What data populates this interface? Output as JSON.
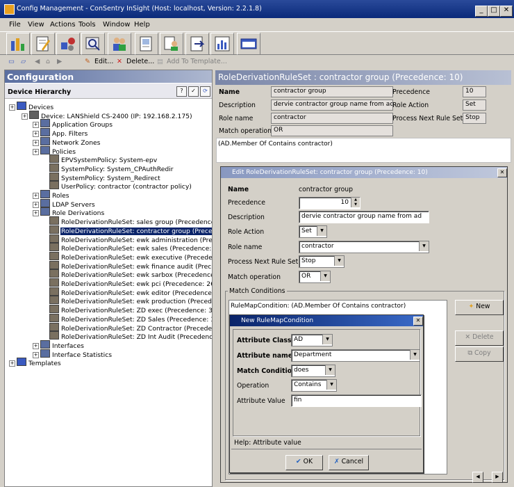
{
  "window": {
    "title": "Config Management - ConSentry InSight (Host: localhost, Version: 2.2.1.8)"
  },
  "menu": [
    "File",
    "View",
    "Actions",
    "Tools",
    "Window",
    "Help"
  ],
  "toolbar2": {
    "edit": "Edit...",
    "delete": "Delete...",
    "add_template": "Add To Template..."
  },
  "left": {
    "title": "Configuration",
    "hierarchy_title": "Device Hierarchy",
    "tree": [
      {
        "label": "Devices",
        "level": 0
      },
      {
        "label": "Device: LANShield CS-2400 (IP: 192.168.2.175)",
        "level": 1
      },
      {
        "label": "Application Groups",
        "level": 2
      },
      {
        "label": "App. Filters",
        "level": 2
      },
      {
        "label": "Network Zones",
        "level": 2
      },
      {
        "label": "Policies",
        "level": 2
      },
      {
        "label": "EPVSystemPolicy: System-epv",
        "level": 3
      },
      {
        "label": "SystemPolicy: System_CPAuthRedir",
        "level": 3
      },
      {
        "label": "SystemPolicy: System_Redirect",
        "level": 3
      },
      {
        "label": "UserPolicy: contractor (contractor policy)",
        "level": 3
      },
      {
        "label": "Roles",
        "level": 2
      },
      {
        "label": "LDAP Servers",
        "level": 2
      },
      {
        "label": "Role Derivations",
        "level": 2
      },
      {
        "label": "RoleDerivationRuleSet: sales group (Precedence",
        "level": 3
      },
      {
        "label": "RoleDerivationRuleSet: contractor group (Preced",
        "level": 3,
        "selected": true
      },
      {
        "label": "RoleDerivationRuleSet: ewk administration (Prec",
        "level": 3
      },
      {
        "label": "RoleDerivationRuleSet: ewk sales (Precedence: ",
        "level": 3
      },
      {
        "label": "RoleDerivationRuleSet: ewk executive (Precedenc",
        "level": 3
      },
      {
        "label": "RoleDerivationRuleSet: ewk finance audit (Prece",
        "level": 3
      },
      {
        "label": "RoleDerivationRuleSet: ewk sarbox (Precedence:",
        "level": 3
      },
      {
        "label": "RoleDerivationRuleSet: ewk pci (Precedence: 26",
        "level": 3
      },
      {
        "label": "RoleDerivationRuleSet: ewk editor (Precedence:",
        "level": 3
      },
      {
        "label": "RoleDerivationRuleSet: ewk production (Precede",
        "level": 3
      },
      {
        "label": "RoleDerivationRuleSet: ZD exec (Precedence: 30",
        "level": 3
      },
      {
        "label": "RoleDerivationRuleSet: ZD Sales (Precedence: 3",
        "level": 3
      },
      {
        "label": "RoleDerivationRuleSet: ZD Contractor (Precede",
        "level": 3
      },
      {
        "label": "RoleDerivationRuleSet: ZD Int Audit (Precedence",
        "level": 3
      },
      {
        "label": "Interfaces",
        "level": 2
      },
      {
        "label": "Interface Statistics",
        "level": 2
      },
      {
        "label": "Templates",
        "level": 0
      }
    ]
  },
  "ruleset": {
    "header": "RoleDerivationRuleSet : contractor group (Precedence: 10)",
    "name_label": "Name",
    "name_value": "contractor group",
    "precedence_label": "Precedence",
    "precedence_value": "10",
    "description_label": "Description",
    "description_value": "dervie contractor group name from ad",
    "role_action_label": "Role Action",
    "role_action_value": "Set",
    "role_name_label": "Role name",
    "role_name_value": "contractor",
    "process_next_label": "Process Next Rule Set",
    "process_next_value": "Stop",
    "match_op_label": "Match operation",
    "match_op_value": "OR",
    "condition": "(AD.Member Of Contains contractor)"
  },
  "edit_dialog": {
    "title": "Edit RoleDerivationRuleSet: contractor group (Precedence: 10)",
    "name_label": "Name",
    "name_value": "contractor group",
    "precedence_label": "Precedence",
    "precedence_value": "10",
    "description_label": "Description",
    "description_value": "dervie contractor group name from ad",
    "role_action_label": "Role Action",
    "role_action_value": "Set",
    "role_name_label": "Role name",
    "role_name_value": "contractor",
    "process_next_label": "Process Next Rule Set",
    "process_next_value": "Stop",
    "match_op_label": "Match operation",
    "match_op_value": "OR",
    "match_conditions_label": "Match Conditions",
    "condition_item": "RuleMapCondition: (AD.Member Of Contains contractor)",
    "new_button": "New",
    "delete_button": "Delete",
    "copy_button": "Copy"
  },
  "new_dialog": {
    "title": "New RuleMapCondition",
    "attr_class_label": "Attribute Class",
    "attr_class_value": "AD",
    "attr_name_label": "Attribute name",
    "attr_name_value": "Department",
    "match_cond_label": "Match Condition",
    "match_cond_value": "does",
    "operation_label": "Operation",
    "operation_value": "Contains",
    "attr_value_label": "Attribute Value",
    "attr_value_value": "fin",
    "help": "Help: Attribute value",
    "ok": "OK",
    "cancel": "Cancel"
  }
}
